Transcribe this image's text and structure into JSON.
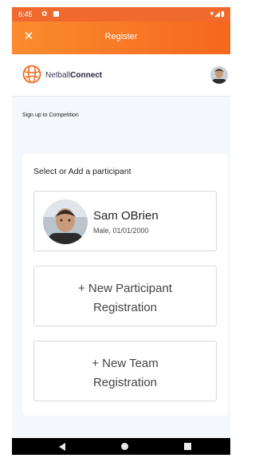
{
  "status_bar": {
    "time": "6:45",
    "icons": [
      "settings-icon",
      "sd-card-icon",
      "wifi-icon",
      "signal-icon",
      "battery-icon"
    ]
  },
  "app_bar": {
    "title": "Register",
    "close_icon": "close-icon"
  },
  "brand": {
    "name_regular": "Netball",
    "name_bold": "Connect",
    "logo_icon": "netball-logo-icon"
  },
  "page": {
    "section_label": "Sign up to Competition"
  },
  "card": {
    "heading": "Select or Add a participant",
    "participant": {
      "name": "Sam OBrien",
      "details": "Male, 01/01/2000"
    },
    "new_participant_line1": "+ New Participant",
    "new_participant_line2": "Registration",
    "new_team_line1": "+ New Team",
    "new_team_line2": "Registration"
  },
  "colors": {
    "accent": "#f5671e",
    "accent_light": "#fb8c2e",
    "background": "#f4f7fb"
  },
  "nav": {
    "icons": [
      "back-icon",
      "home-icon",
      "recents-icon"
    ]
  }
}
